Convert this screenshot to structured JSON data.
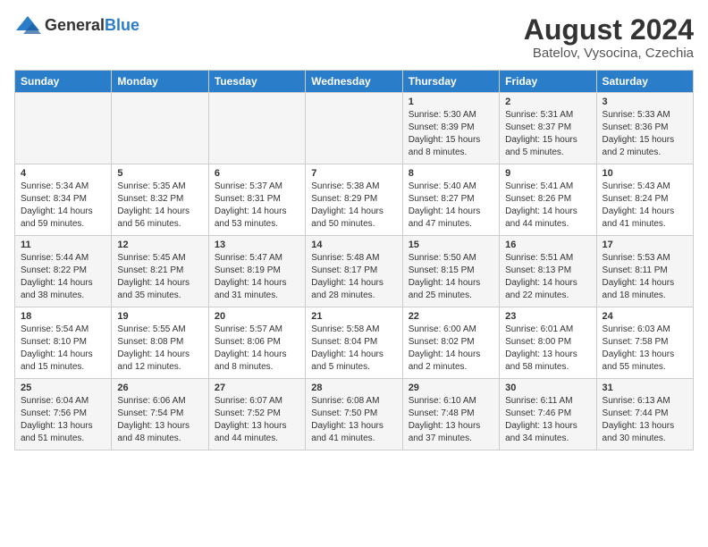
{
  "header": {
    "logo_general": "General",
    "logo_blue": "Blue",
    "title": "August 2024",
    "subtitle": "Batelov, Vysocina, Czechia"
  },
  "days_of_week": [
    "Sunday",
    "Monday",
    "Tuesday",
    "Wednesday",
    "Thursday",
    "Friday",
    "Saturday"
  ],
  "weeks": [
    [
      {
        "day": "",
        "info": ""
      },
      {
        "day": "",
        "info": ""
      },
      {
        "day": "",
        "info": ""
      },
      {
        "day": "",
        "info": ""
      },
      {
        "day": "1",
        "info": "Sunrise: 5:30 AM\nSunset: 8:39 PM\nDaylight: 15 hours\nand 8 minutes."
      },
      {
        "day": "2",
        "info": "Sunrise: 5:31 AM\nSunset: 8:37 PM\nDaylight: 15 hours\nand 5 minutes."
      },
      {
        "day": "3",
        "info": "Sunrise: 5:33 AM\nSunset: 8:36 PM\nDaylight: 15 hours\nand 2 minutes."
      }
    ],
    [
      {
        "day": "4",
        "info": "Sunrise: 5:34 AM\nSunset: 8:34 PM\nDaylight: 14 hours\nand 59 minutes."
      },
      {
        "day": "5",
        "info": "Sunrise: 5:35 AM\nSunset: 8:32 PM\nDaylight: 14 hours\nand 56 minutes."
      },
      {
        "day": "6",
        "info": "Sunrise: 5:37 AM\nSunset: 8:31 PM\nDaylight: 14 hours\nand 53 minutes."
      },
      {
        "day": "7",
        "info": "Sunrise: 5:38 AM\nSunset: 8:29 PM\nDaylight: 14 hours\nand 50 minutes."
      },
      {
        "day": "8",
        "info": "Sunrise: 5:40 AM\nSunset: 8:27 PM\nDaylight: 14 hours\nand 47 minutes."
      },
      {
        "day": "9",
        "info": "Sunrise: 5:41 AM\nSunset: 8:26 PM\nDaylight: 14 hours\nand 44 minutes."
      },
      {
        "day": "10",
        "info": "Sunrise: 5:43 AM\nSunset: 8:24 PM\nDaylight: 14 hours\nand 41 minutes."
      }
    ],
    [
      {
        "day": "11",
        "info": "Sunrise: 5:44 AM\nSunset: 8:22 PM\nDaylight: 14 hours\nand 38 minutes."
      },
      {
        "day": "12",
        "info": "Sunrise: 5:45 AM\nSunset: 8:21 PM\nDaylight: 14 hours\nand 35 minutes."
      },
      {
        "day": "13",
        "info": "Sunrise: 5:47 AM\nSunset: 8:19 PM\nDaylight: 14 hours\nand 31 minutes."
      },
      {
        "day": "14",
        "info": "Sunrise: 5:48 AM\nSunset: 8:17 PM\nDaylight: 14 hours\nand 28 minutes."
      },
      {
        "day": "15",
        "info": "Sunrise: 5:50 AM\nSunset: 8:15 PM\nDaylight: 14 hours\nand 25 minutes."
      },
      {
        "day": "16",
        "info": "Sunrise: 5:51 AM\nSunset: 8:13 PM\nDaylight: 14 hours\nand 22 minutes."
      },
      {
        "day": "17",
        "info": "Sunrise: 5:53 AM\nSunset: 8:11 PM\nDaylight: 14 hours\nand 18 minutes."
      }
    ],
    [
      {
        "day": "18",
        "info": "Sunrise: 5:54 AM\nSunset: 8:10 PM\nDaylight: 14 hours\nand 15 minutes."
      },
      {
        "day": "19",
        "info": "Sunrise: 5:55 AM\nSunset: 8:08 PM\nDaylight: 14 hours\nand 12 minutes."
      },
      {
        "day": "20",
        "info": "Sunrise: 5:57 AM\nSunset: 8:06 PM\nDaylight: 14 hours\nand 8 minutes."
      },
      {
        "day": "21",
        "info": "Sunrise: 5:58 AM\nSunset: 8:04 PM\nDaylight: 14 hours\nand 5 minutes."
      },
      {
        "day": "22",
        "info": "Sunrise: 6:00 AM\nSunset: 8:02 PM\nDaylight: 14 hours\nand 2 minutes."
      },
      {
        "day": "23",
        "info": "Sunrise: 6:01 AM\nSunset: 8:00 PM\nDaylight: 13 hours\nand 58 minutes."
      },
      {
        "day": "24",
        "info": "Sunrise: 6:03 AM\nSunset: 7:58 PM\nDaylight: 13 hours\nand 55 minutes."
      }
    ],
    [
      {
        "day": "25",
        "info": "Sunrise: 6:04 AM\nSunset: 7:56 PM\nDaylight: 13 hours\nand 51 minutes."
      },
      {
        "day": "26",
        "info": "Sunrise: 6:06 AM\nSunset: 7:54 PM\nDaylight: 13 hours\nand 48 minutes."
      },
      {
        "day": "27",
        "info": "Sunrise: 6:07 AM\nSunset: 7:52 PM\nDaylight: 13 hours\nand 44 minutes."
      },
      {
        "day": "28",
        "info": "Sunrise: 6:08 AM\nSunset: 7:50 PM\nDaylight: 13 hours\nand 41 minutes."
      },
      {
        "day": "29",
        "info": "Sunrise: 6:10 AM\nSunset: 7:48 PM\nDaylight: 13 hours\nand 37 minutes."
      },
      {
        "day": "30",
        "info": "Sunrise: 6:11 AM\nSunset: 7:46 PM\nDaylight: 13 hours\nand 34 minutes."
      },
      {
        "day": "31",
        "info": "Sunrise: 6:13 AM\nSunset: 7:44 PM\nDaylight: 13 hours\nand 30 minutes."
      }
    ]
  ]
}
